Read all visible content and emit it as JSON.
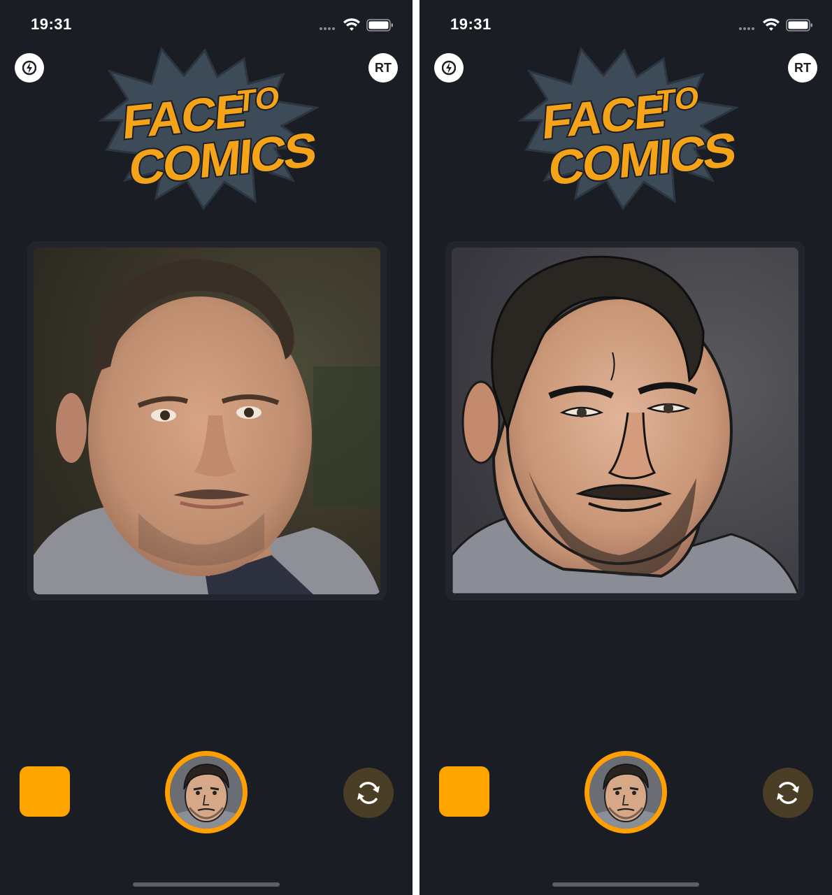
{
  "screens": [
    {
      "id": "original",
      "status_bar": {
        "time": "19:31"
      },
      "top_bar": {
        "left_icon": "lightning-icon",
        "right_label": "RT"
      },
      "logo": {
        "line1": "FACE",
        "line1_small": "TO",
        "line2": "COMICS"
      },
      "photo": {
        "style": "photo",
        "description": "portrait"
      },
      "bottom_bar": {
        "swatch_color": "#FFA500",
        "avatar_icon": "comic-avatar-icon",
        "refresh_icon": "refresh-icon"
      }
    },
    {
      "id": "comic",
      "status_bar": {
        "time": "19:31"
      },
      "top_bar": {
        "left_icon": "lightning-icon",
        "right_label": "RT"
      },
      "logo": {
        "line1": "FACE",
        "line1_small": "TO",
        "line2": "COMICS"
      },
      "photo": {
        "style": "comic"
      },
      "bottom_bar": {
        "swatch_color": "#FFA500",
        "avatar_icon": "comic-avatar-icon",
        "refresh_icon": "refresh-icon"
      }
    }
  ],
  "colors": {
    "background": "#1B1D24",
    "accent": "#FFA500",
    "refresh_bg": "#4A3E26"
  }
}
